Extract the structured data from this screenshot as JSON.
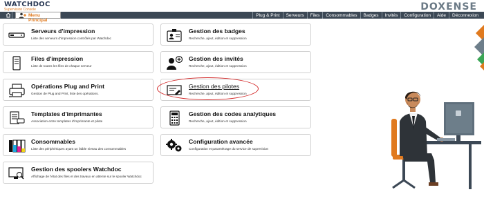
{
  "header": {
    "logo_main": "WATCHDOC",
    "logo_sub": "Supervision Console",
    "brand": "DOXENSE",
    "menu_principal": "Menu Principal"
  },
  "nav": {
    "items": [
      "Plug & Print",
      "Serveurs",
      "Files",
      "Consommables",
      "Badges",
      "Invités",
      "Configuration",
      "Aide",
      "Déconnexion"
    ]
  },
  "cards": {
    "serveurs": {
      "title": "Serveurs d'impression",
      "desc": "Liste des serveurs d'impression contrôlés par Watchdoc"
    },
    "files": {
      "title": "Files d'impression",
      "desc": "Liste de toutes les files de chaque serveur"
    },
    "plugprint": {
      "title": "Opérations Plug and Print",
      "desc": "Gestion de Plug and Print, liste des opérations."
    },
    "templates": {
      "title": "Templates d'imprimantes",
      "desc": "Association entre templates d'imprimante et pilote"
    },
    "consommables": {
      "title": "Consommables",
      "desc": "Liste des périphériques ayant un faible niveau des consommables"
    },
    "spoolers": {
      "title": "Gestion des spoolers Watchdoc",
      "desc": "Affichage de l'état des files et des travaux en attente sur le spooler Watchdoc"
    },
    "badges": {
      "title": "Gestion des badges",
      "desc": "Recherche, ajout, édition et suppression"
    },
    "invites": {
      "title": "Gestion des invités",
      "desc": "Recherche, ajout, édition et suppression"
    },
    "pilotes": {
      "title": "Gestion des pilotes",
      "desc": "Recherche, ajout, édition et suppression"
    },
    "analytiques": {
      "title": "Gestion des codes analytiques",
      "desc": "Recherche, ajout, édition et suppression"
    },
    "configuration": {
      "title": "Configuration avancée",
      "desc": "Configuration et paramétrage du service de supervision"
    }
  },
  "colors": {
    "nav_bg": "#3c4855",
    "accent_orange": "#e07a1f",
    "highlight_red": "#d42a2a"
  }
}
